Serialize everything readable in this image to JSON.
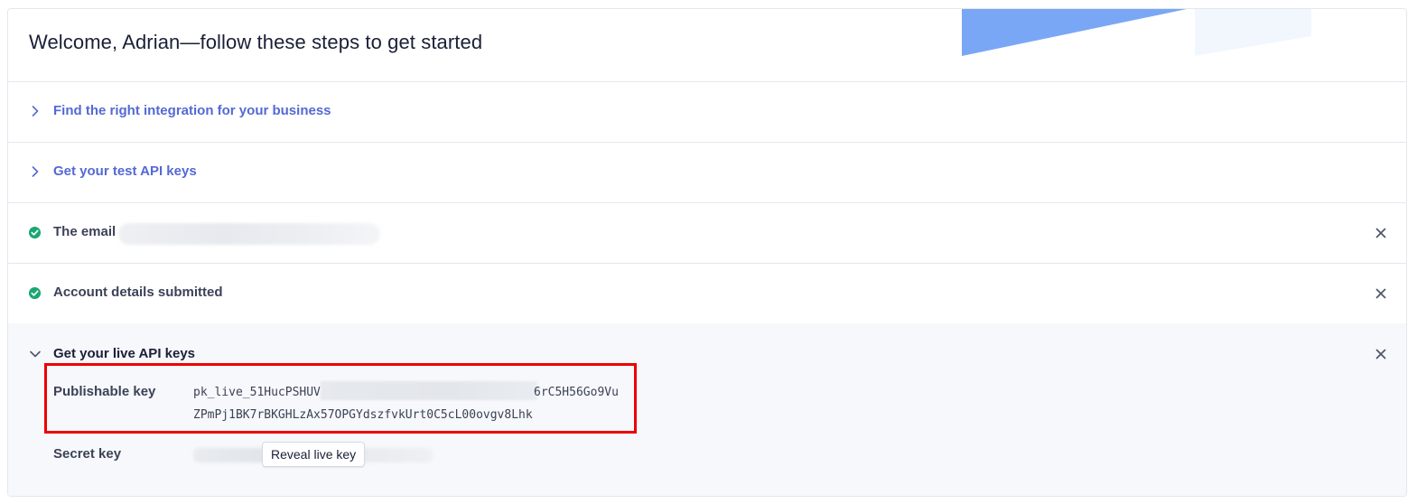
{
  "header": {
    "title": "Welcome, Adrian—follow these steps to get started"
  },
  "steps": [
    {
      "label": "Find the right integration for your business",
      "state": "collapsed",
      "icon": "chevron-right-icon"
    },
    {
      "label": "Get your test API keys",
      "state": "collapsed",
      "icon": "chevron-right-icon"
    },
    {
      "label": "The email",
      "state": "done",
      "icon": "check-circle-icon"
    },
    {
      "label": "Account details submitted",
      "state": "done",
      "icon": "check-circle-icon"
    },
    {
      "label": "Get your live API keys",
      "state": "expanded",
      "icon": "chevron-down-icon"
    }
  ],
  "live_keys": {
    "publishable_label": "Publishable key",
    "publishable_line1_start": "pk_live_51HucPSHUV",
    "publishable_line1_end": "6rC5H56Go9Vu",
    "publishable_line2": "ZPmPj1BK7rBKGHLzAx57OPGYdszfvkUrt0C5cL00ovgv8Lhk",
    "secret_label": "Secret key",
    "reveal_button": "Reveal live key"
  },
  "colors": {
    "link": "#5469d4",
    "success": "#1ea672",
    "highlight": "#ec0000",
    "accent": "#7aa7f5"
  }
}
